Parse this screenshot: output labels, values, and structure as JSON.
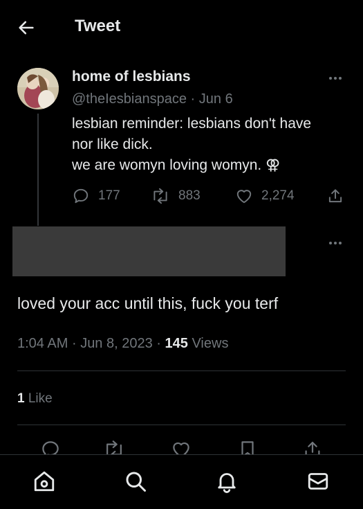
{
  "header": {
    "title": "Tweet",
    "back_icon": "arrow-left-icon"
  },
  "original_tweet": {
    "display_name": "home of lesbians",
    "handle": "@theIesbianspace",
    "separator": "·",
    "date": "Jun 6",
    "text_lines": [
      "lesbian reminder: lesbians don't have",
      "nor like dick.",
      "we are womyn loving womyn. ⚢"
    ],
    "counts": {
      "replies": "177",
      "retweets": "883",
      "likes": "2,274"
    }
  },
  "reply": {
    "text": "loved your acc until this, fuck you terf",
    "time": "1:04 AM",
    "separator": "·",
    "date": "Jun 8, 2023",
    "views_count": "145",
    "views_label": "Views",
    "likes_count": "1",
    "likes_label": "Like"
  },
  "bottom_nav": {
    "items": [
      "home-icon",
      "search-icon",
      "notifications-icon",
      "messages-icon"
    ]
  },
  "colors": {
    "background": "#000000",
    "text_primary": "#e7e9ea",
    "text_secondary": "#71767b",
    "divider": "#2f3336",
    "redaction": "#3a3a3a"
  }
}
